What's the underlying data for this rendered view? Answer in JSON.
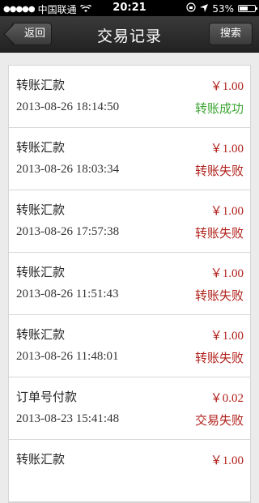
{
  "status_bar": {
    "carrier": "中国联通",
    "time": "20:21",
    "battery": "53%",
    "battery_level": 0.53
  },
  "nav": {
    "back_label": "返回",
    "title": "交易记录",
    "search_label": "搜索"
  },
  "colors": {
    "amount": "#b1201b",
    "success": "#3aa431",
    "fail": "#b1201b"
  },
  "records": [
    {
      "type": "转账汇款",
      "amount": "￥1.00",
      "time": "2013-08-26 18:14:50",
      "status": "转账成功",
      "status_kind": "success"
    },
    {
      "type": "转账汇款",
      "amount": "￥1.00",
      "time": "2013-08-26 18:03:34",
      "status": "转账失败",
      "status_kind": "fail"
    },
    {
      "type": "转账汇款",
      "amount": "￥1.00",
      "time": "2013-08-26 17:57:38",
      "status": "转账失败",
      "status_kind": "fail"
    },
    {
      "type": "转账汇款",
      "amount": "￥1.00",
      "time": "2013-08-26 11:51:43",
      "status": "转账失败",
      "status_kind": "fail"
    },
    {
      "type": "转账汇款",
      "amount": "￥1.00",
      "time": "2013-08-26 11:48:01",
      "status": "转账失败",
      "status_kind": "fail"
    },
    {
      "type": "订单号付款",
      "amount": "￥0.02",
      "time": "2013-08-23 15:41:48",
      "status": "交易失败",
      "status_kind": "fail"
    },
    {
      "type": "转账汇款",
      "amount": "￥1.00",
      "time": "",
      "status": "",
      "status_kind": "fail"
    }
  ]
}
